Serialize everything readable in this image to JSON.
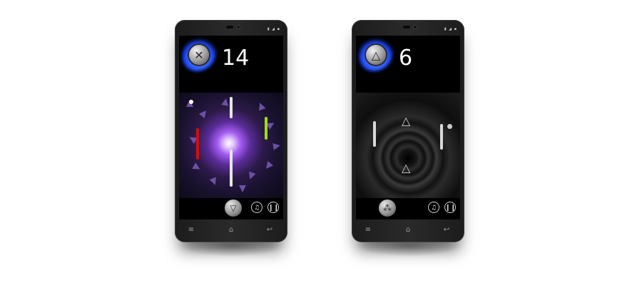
{
  "phones": [
    {
      "status_icons": "▮ ◢ ▪",
      "score": "14",
      "emblem_icon": "silver-coin-icon",
      "theme": {
        "tunnel": "#a35cf0",
        "left_paddle": "#d01010",
        "right_paddle": "#9fe000",
        "center_paddle": "#e6e6e6"
      }
    },
    {
      "status_icons": "▮ ◢ ▪",
      "score": "6",
      "emblem_icon": "triangle-knot-icon",
      "theme": {
        "tunnel": "#2e2e2e",
        "left_paddle": "#d8d8d8",
        "right_paddle": "#d8d8d8"
      }
    }
  ],
  "controls": {
    "music_icon": "♫",
    "pause_icon": "❙❙"
  },
  "navbar": {
    "menu_icon": "≡",
    "home_icon": "⌂",
    "back_icon": "↩"
  }
}
